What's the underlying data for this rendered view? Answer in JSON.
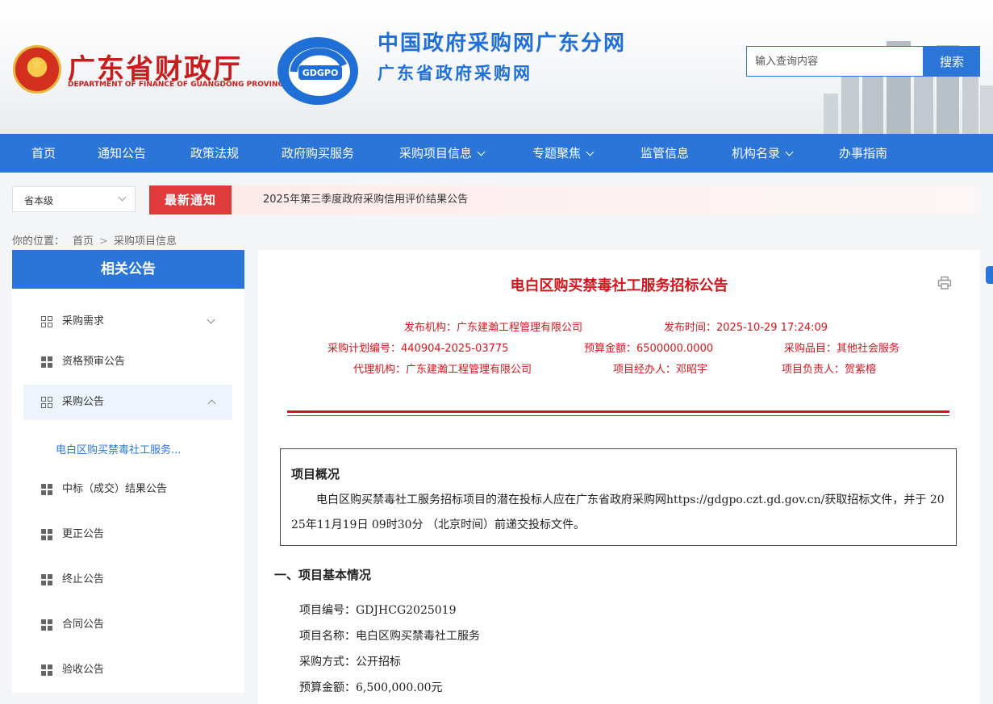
{
  "header": {
    "org_name_cn": "广东省财政厅",
    "org_name_en": "DEPARTMENT OF FINANCE OF GUANGDONG PROVINCE",
    "logo_text": "GDGPO",
    "site_title_1": "中国政府采购网广东分网",
    "site_title_2": "广东省政府采购网",
    "search_placeholder": "输入查询内容",
    "search_button": "搜索"
  },
  "nav": {
    "items": [
      {
        "label": "首页",
        "has_dropdown": false
      },
      {
        "label": "通知公告",
        "has_dropdown": false
      },
      {
        "label": "政策法规",
        "has_dropdown": false
      },
      {
        "label": "政府购买服务",
        "has_dropdown": false
      },
      {
        "label": "采购项目信息",
        "has_dropdown": true
      },
      {
        "label": "专题聚焦",
        "has_dropdown": true
      },
      {
        "label": "监管信息",
        "has_dropdown": false
      },
      {
        "label": "机构名录",
        "has_dropdown": true
      },
      {
        "label": "办事指南",
        "has_dropdown": false
      }
    ]
  },
  "notice": {
    "level_select": "省本级",
    "badge": "最新通知",
    "text": "2025年第三季度政府采购信用评价结果公告"
  },
  "breadcrumb": {
    "prefix": "你的位置：",
    "items": [
      "首页",
      "采购项目信息"
    ]
  },
  "sidebar": {
    "title": "相关公告",
    "items": [
      {
        "label": "采购需求",
        "icon": "grid-outline-icon",
        "expandable": true
      },
      {
        "label": "资格预审公告",
        "icon": "grid-filled-icon"
      },
      {
        "label": "采购公告",
        "icon": "grid-outline-icon",
        "expandable": true,
        "active": true
      },
      {
        "label": "中标（成交）结果公告",
        "icon": "grid-filled-icon"
      },
      {
        "label": "更正公告",
        "icon": "grid-filled-icon"
      },
      {
        "label": "终止公告",
        "icon": "grid-filled-icon"
      },
      {
        "label": "合同公告",
        "icon": "grid-filled-icon"
      },
      {
        "label": "验收公告",
        "icon": "grid-filled-icon"
      }
    ],
    "sub_item": "电白区购买禁毒社工服务..."
  },
  "document": {
    "title": "电白区购买禁毒社工服务招标公告",
    "meta": {
      "publisher": "发布机构：广东建瀚工程管理有限公司",
      "publish_time": "发布时间：2025-10-29 17:24:09",
      "plan_no": "采购计划编号：440904-2025-03775",
      "budget": "预算金额：6500000.0000",
      "category": "采购品目：其他社会服务",
      "agency": "代理机构：广东建瀚工程管理有限公司",
      "handler": "项目经办人：邓昭宇",
      "leader": "项目负责人：贺紫榕"
    },
    "summary_title": "项目概况",
    "summary_body": "电白区购买禁毒社工服务招标项目的潜在投标人应在广东省政府采购网https://gdgpo.czt.gd.gov.cn/获取招标文件，并于 2025年11月19日 09时30分 （北京时间）前递交投标文件。",
    "section1_title": "一、项目基本情况",
    "fields": {
      "project_no": "项目编号：GDJHCG2025019",
      "project_name": "项目名称：电白区购买禁毒社工服务",
      "method": "采购方式：公开招标",
      "budget": "预算金额：6,500,000.00元"
    }
  },
  "colors": {
    "primary_blue": "#2b75d8",
    "accent_red": "#d6161d",
    "badge_red": "#e03b3b"
  }
}
